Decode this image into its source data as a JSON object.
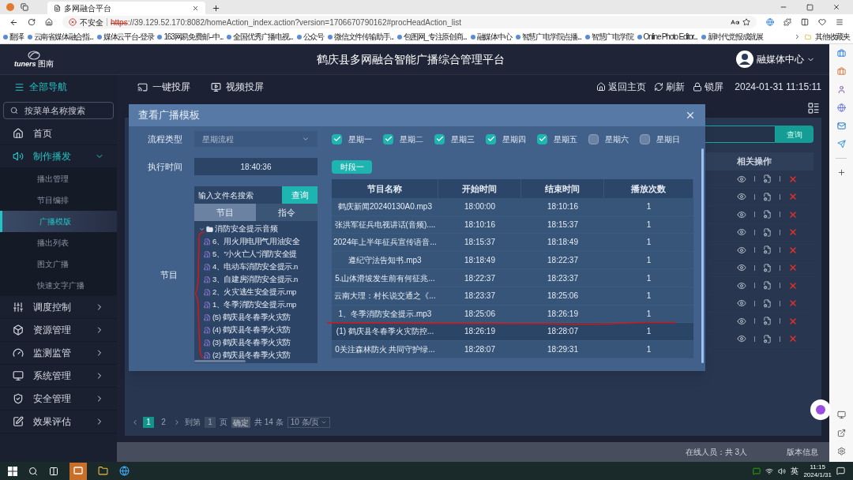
{
  "browser": {
    "tab_title": "多网融合平台",
    "security": "不安全",
    "url_scheme": "https",
    "url_rest": "://39.129.52.170:8082/homeAction_index.action?version=1706670790162#procHeadAction_list",
    "bookmarks": [
      "翻泽",
      "云南省媒体融合指...",
      "媒体云平台-登录",
      "163网易免费邮--中...",
      "全国优秀广播电视...",
      "公众号",
      "微信文件传输助手...",
      "包图网_专注原创商...",
      "融媒体中心",
      "智慧广电学院点播...",
      "智慧广电学院",
      "Online Photo Editor...",
      "新时代党报成就展"
    ],
    "other_bookmarks": "其他收藏夹"
  },
  "header": {
    "logo": "tuners",
    "logo_sub": "图南",
    "title": "鹤庆县多网融合智能广播综合管理平台",
    "user": "融媒体中心"
  },
  "nav": {
    "all_nav": "全部导航",
    "menu_search_placeholder": "按菜单名称搜索",
    "left": [
      "一键投屏",
      "视频投屏"
    ],
    "right": [
      "返回主页",
      "刷新",
      "锁屏"
    ],
    "datetime": "2024-01-31 11:15:11"
  },
  "sidebar": {
    "items": [
      {
        "label": "首页",
        "selected": false
      },
      {
        "label": "制作播发",
        "selected": true,
        "expanded": true,
        "children": [
          {
            "label": "播出管理",
            "selected": false
          },
          {
            "label": "节目编排",
            "selected": false
          },
          {
            "label": "广播模版",
            "selected": true
          },
          {
            "label": "播出列表",
            "selected": false
          },
          {
            "label": "图文广播",
            "selected": false
          },
          {
            "label": "快速文字广播",
            "selected": false
          }
        ]
      },
      {
        "label": "调度控制",
        "selected": false,
        "expanded": false
      },
      {
        "label": "资源管理",
        "selected": false,
        "expanded": false
      },
      {
        "label": "监测监管",
        "selected": false,
        "expanded": false
      },
      {
        "label": "系统管理",
        "selected": false,
        "expanded": false
      },
      {
        "label": "安全管理",
        "selected": false,
        "expanded": false
      },
      {
        "label": "效果评估",
        "selected": false,
        "expanded": false
      }
    ]
  },
  "page": {
    "search_button": "查询",
    "table": {
      "columns": [
        "相关操作"
      ]
    },
    "pagination": {
      "pages": [
        {
          "label": "1",
          "selected": true
        },
        {
          "label": "2",
          "selected": false
        }
      ],
      "goto_label": "到第",
      "goto_value": "1",
      "page_unit": "页",
      "confirm": "确定",
      "total": "共 14 条",
      "page_size": "10 条/页"
    },
    "footer": {
      "online": "在线人员：共 3人",
      "version": "版本信息"
    }
  },
  "modal": {
    "title": "查看广播模板",
    "flow_type": {
      "label": "流程类型",
      "value": "星期流程"
    },
    "exec_time": {
      "label": "执行时间",
      "value": "18:40:36"
    },
    "program_label": "节目",
    "file_search": {
      "placeholder": "输入文件名搜索",
      "button": "查询"
    },
    "tabs": [
      {
        "label": "节目",
        "selected": true
      },
      {
        "label": "指令",
        "selected": false
      }
    ],
    "tree": [
      {
        "label": "消防安全提示音频",
        "expanded": true,
        "children": [
          {
            "label": "6、用火用电用气用油安全"
          },
          {
            "label": "5、\"小火亡人\"消防安全提"
          },
          {
            "label": "4、电动车消防安全提示.n"
          },
          {
            "label": "3、自建房消防安全提示.n"
          },
          {
            "label": "2、火灾逃生安全提示.mp"
          },
          {
            "label": "1、冬季消防安全提示.mp"
          },
          {
            "label": "(5) 鹤庆县冬春季火灾防"
          },
          {
            "label": "(4) 鹤庆县冬春季火灾防"
          },
          {
            "label": "(3) 鹤庆县冬春季火灾防"
          },
          {
            "label": "(2) 鹤庆县冬春季火灾防"
          }
        ]
      }
    ],
    "weekdays": [
      {
        "label": "星期一",
        "checked": true
      },
      {
        "label": "星期二",
        "checked": true
      },
      {
        "label": "星期三",
        "checked": true
      },
      {
        "label": "星期四",
        "checked": true
      },
      {
        "label": "星期五",
        "checked": true
      },
      {
        "label": "星期六",
        "checked": false
      },
      {
        "label": "星期日",
        "checked": false
      }
    ],
    "period_button": "时段一",
    "table": {
      "columns": [
        "节目名称",
        "开始时间",
        "结束时间",
        "播放次数"
      ],
      "rows": [
        {
          "name": "鹤庆新闻20240130A0.mp3",
          "start": "18:00:00",
          "end": "18:10:16",
          "count": "1",
          "selected": false
        },
        {
          "name": "张洪军征兵电视讲话(音频)....",
          "start": "18:10:16",
          "end": "18:15:37",
          "count": "1",
          "selected": false
        },
        {
          "name": "2024年上半年征兵宣传语音...",
          "start": "18:15:37",
          "end": "18:18:49",
          "count": "1",
          "selected": false
        },
        {
          "name": "遵纪守法告知书.mp3",
          "start": "18:18:49",
          "end": "18:22:37",
          "count": "1",
          "selected": false
        },
        {
          "name": "5.山体滑坡发生前有何征兆...",
          "start": "18:22:37",
          "end": "18:23:37",
          "count": "1",
          "selected": false
        },
        {
          "name": "云南大理：村长说交通之《...",
          "start": "18:23:37",
          "end": "18:25:06",
          "count": "1",
          "selected": false
        },
        {
          "name": "1、冬季消防安全提示.mp3",
          "start": "18:25:06",
          "end": "18:26:19",
          "count": "1",
          "selected": false
        },
        {
          "name": "(1) 鹤庆县冬春季火灾防控...",
          "start": "18:26:19",
          "end": "18:28:07",
          "count": "1",
          "selected": true
        },
        {
          "name": "0关注森林防火 共同守护绿...",
          "start": "18:28:07",
          "end": "18:29:31",
          "count": "1",
          "selected": false
        }
      ]
    }
  },
  "taskbar": {
    "ime": "英",
    "time": "11:15",
    "date": "2024/1/31"
  }
}
